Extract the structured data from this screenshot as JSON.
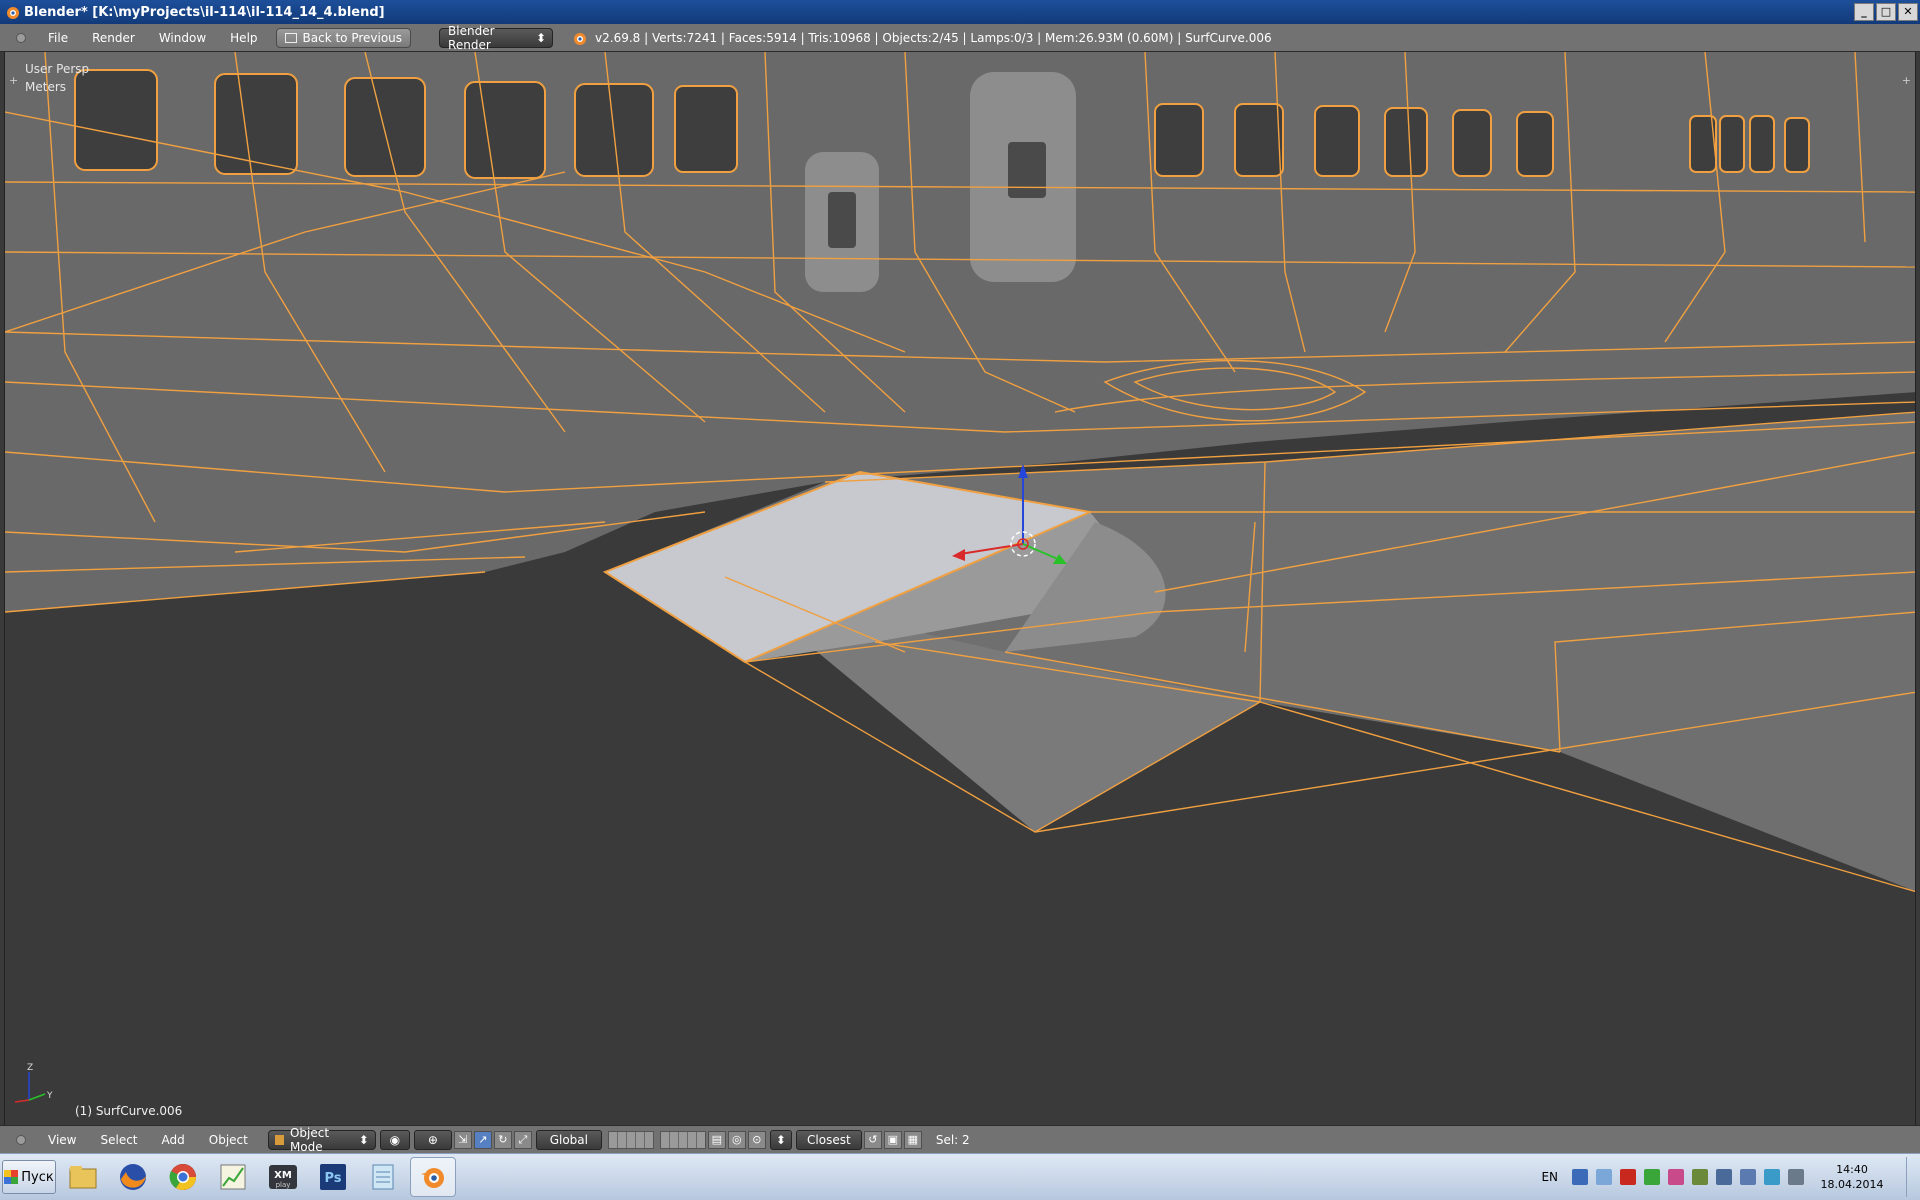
{
  "window": {
    "title": "Blender* [K:\\myProjects\\il-114\\il-114_14_4.blend]",
    "controls": [
      "_",
      "□",
      "✕"
    ]
  },
  "info_header": {
    "menus": [
      "File",
      "Render",
      "Window",
      "Help"
    ],
    "back_button": "Back to Previous",
    "render_engine": "Blender Render",
    "stats": "v2.69.8 | Verts:7241 | Faces:5914 | Tris:10968 | Objects:2/45 | Lamps:0/3 | Mem:26.93M (0.60M) | SurfCurve.006"
  },
  "viewport": {
    "view_name": "User Persp",
    "units": "Meters",
    "active_object": "(1) SurfCurve.006",
    "axis_labels": {
      "z": "Z",
      "y": "Y"
    },
    "colors": {
      "wire": "#f0a040",
      "background": "#3a3a3a",
      "body": "#6a6a6a",
      "selected_face": "#c7c9cf"
    }
  },
  "view3d_header": {
    "menus": [
      "View",
      "Select",
      "Add",
      "Object"
    ],
    "mode": "Object Mode",
    "orientation": "Global",
    "snap_target": "Closest",
    "selection": "Sel: 2"
  },
  "taskbar": {
    "start_label": "Пуск",
    "apps": [
      "explorer-icon",
      "firefox-icon",
      "chrome-icon",
      "chart-app-icon",
      "xmplay-icon",
      "photoshop-icon",
      "notepad-icon",
      "blender-icon"
    ],
    "language": "EN",
    "time": "14:40",
    "date": "18.04.2014"
  }
}
